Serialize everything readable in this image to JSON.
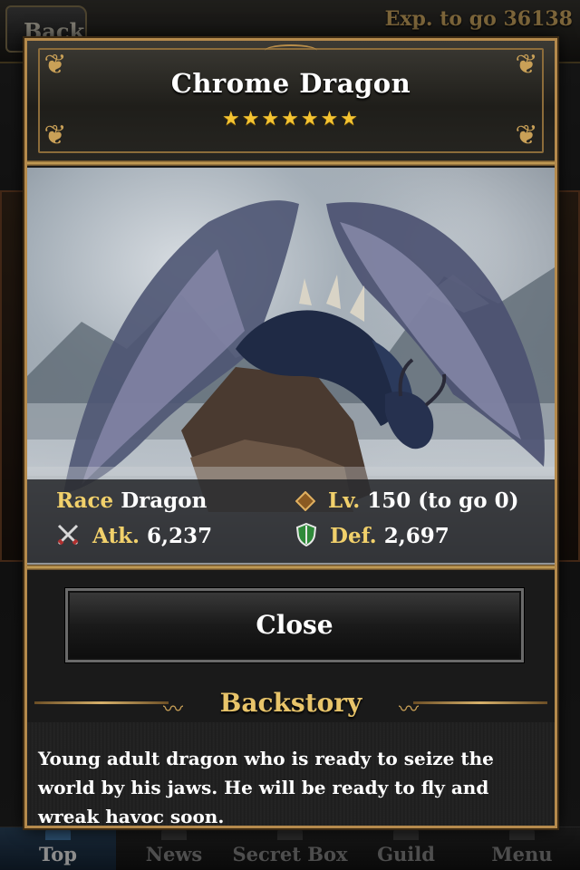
{
  "top_bar": {
    "back_label": "Back",
    "exp_label": "Exp. to go 36138"
  },
  "card": {
    "title": "Chrome Dragon",
    "stars": "★★★★★★★",
    "star_count": 7,
    "stats": {
      "race_key": "Race",
      "race_value": "Dragon",
      "level_key": "Lv.",
      "level_value": "150",
      "level_to_go": "(to go 0)",
      "atk_key": "Atk.",
      "atk_value": "6,237",
      "def_key": "Def.",
      "def_value": "2,697"
    },
    "close_label": "Close",
    "backstory_heading": "Backstory",
    "backstory_text": "Young adult dragon who is ready to seize the world by his jaws. He will be ready to fly and wreak havoc soon."
  },
  "tabs": [
    {
      "label": "Top",
      "active": true
    },
    {
      "label": "News",
      "active": false
    },
    {
      "label": "Secret Box",
      "active": false
    },
    {
      "label": "Guild",
      "active": false
    },
    {
      "label": "Menu",
      "active": false
    }
  ],
  "colors": {
    "gold_accent": "#c9a057",
    "stat_key": "#f1d06b",
    "star": "#f5c431"
  },
  "icons": {
    "level": "diamond-icon",
    "attack": "crossed-swords-icon",
    "defense": "shield-icon"
  }
}
